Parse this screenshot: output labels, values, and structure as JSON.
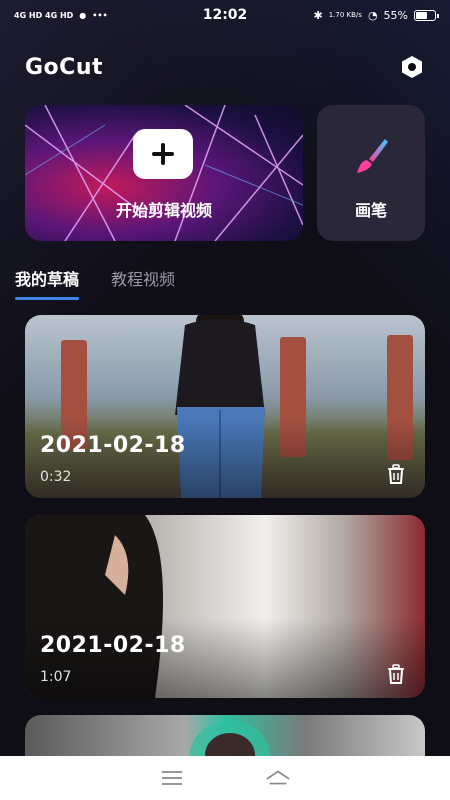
{
  "status_bar": {
    "left_indicators": "4G HD 4G HD",
    "time": "12:02",
    "speed": "1.70 KB/s",
    "battery": "55%"
  },
  "header": {
    "logo": "GoCut",
    "settings_icon": "settings-hexagon-icon"
  },
  "actions": {
    "start_edit_label": "开始剪辑视频",
    "brush_label": "画笔"
  },
  "tabs": [
    {
      "label": "我的草稿",
      "active": true
    },
    {
      "label": "教程视频",
      "active": false
    }
  ],
  "drafts": [
    {
      "date": "2021-02-18",
      "duration": "0:32"
    },
    {
      "date": "2021-02-18",
      "duration": "1:07"
    },
    {
      "date": "",
      "duration": ""
    }
  ],
  "colors": {
    "accent": "#3d86e8",
    "background": "#0f0e17",
    "card": "#2a2838"
  }
}
